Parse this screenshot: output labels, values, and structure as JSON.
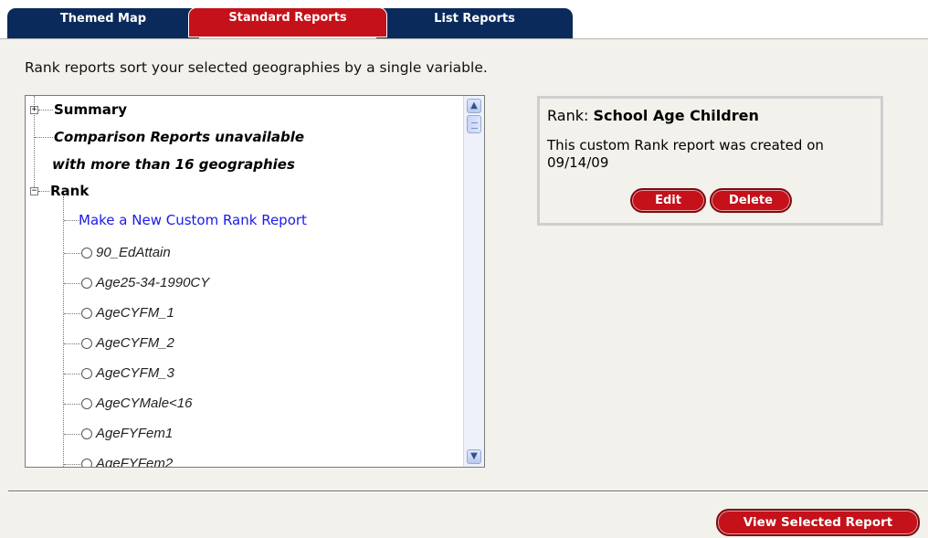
{
  "tabs": [
    {
      "label": "Themed Map",
      "active": false
    },
    {
      "label": "Standard Reports",
      "active": true
    },
    {
      "label": "List Reports",
      "active": false
    }
  ],
  "intro_text": "Rank reports sort your selected geographies by a single variable.",
  "tree": {
    "summary_label": "Summary",
    "comparison_line1": "Comparison Reports unavailable",
    "comparison_line2": "with more than 16 geographies",
    "rank_label": "Rank",
    "new_custom_label": "Make a New Custom Rank Report",
    "items": [
      "90_EdAttain",
      "Age25-34-1990CY",
      "AgeCYFM_1",
      "AgeCYFM_2",
      "AgeCYFM_3",
      "AgeCYMale<16",
      "AgeFYFem1",
      "AgeFYFem2"
    ]
  },
  "info": {
    "rank_prefix": "Rank:",
    "rank_name": "School Age Children",
    "description": "This custom Rank report was created on 09/14/09",
    "edit_label": "Edit",
    "delete_label": "Delete"
  },
  "view_button_label": "View Selected Report",
  "colors": {
    "tab_navy": "#0b2a5c",
    "tab_red": "#c4111a",
    "panel_bg": "#f2f1ec",
    "link_blue": "#1a1ae6"
  },
  "icons": {
    "expand": "plus-box-icon",
    "collapse": "minus-box-icon",
    "scroll_up": "scroll-up-arrow-icon",
    "scroll_down": "scroll-down-arrow-icon"
  }
}
